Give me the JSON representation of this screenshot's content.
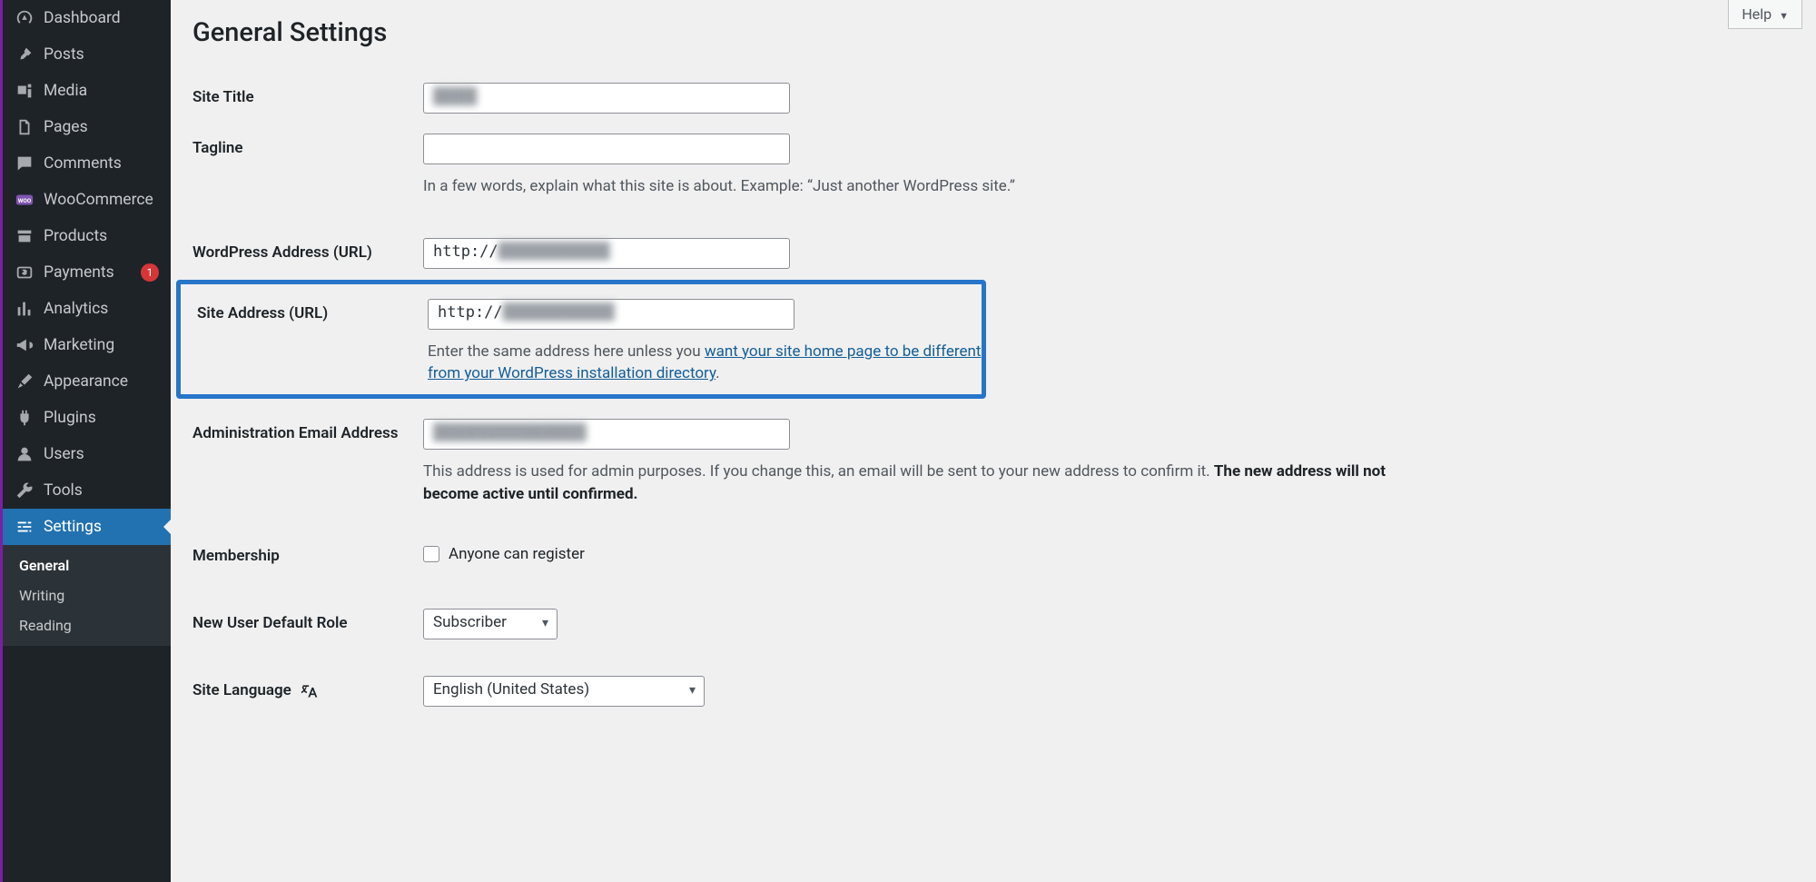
{
  "help_label": "Help",
  "page_title": "General Settings",
  "sidebar": {
    "items": [
      {
        "label": "Dashboard"
      },
      {
        "label": "Posts"
      },
      {
        "label": "Media"
      },
      {
        "label": "Pages"
      },
      {
        "label": "Comments"
      },
      {
        "label": "WooCommerce"
      },
      {
        "label": "Products"
      },
      {
        "label": "Payments",
        "badge": "1"
      },
      {
        "label": "Analytics"
      },
      {
        "label": "Marketing"
      },
      {
        "label": "Appearance"
      },
      {
        "label": "Plugins"
      },
      {
        "label": "Users"
      },
      {
        "label": "Tools"
      },
      {
        "label": "Settings"
      }
    ],
    "submenu": [
      {
        "label": "General"
      },
      {
        "label": "Writing"
      },
      {
        "label": "Reading"
      }
    ]
  },
  "form": {
    "site_title": {
      "label": "Site Title",
      "value": "████"
    },
    "tagline": {
      "label": "Tagline",
      "value": "",
      "description": "In a few words, explain what this site is about. Example: “Just another WordPress site.”"
    },
    "wp_url": {
      "label": "WordPress Address (URL)",
      "value_prefix": "http://",
      "value_blur": "████████████"
    },
    "site_url": {
      "label": "Site Address (URL)",
      "value_prefix": "http://",
      "value_blur": "████████████",
      "desc_before": "Enter the same address here unless you ",
      "desc_link": "want your site home page to be different from your WordPress installation directory",
      "desc_after": "."
    },
    "admin_email": {
      "label": "Administration Email Address",
      "value_blur": "██████████████",
      "desc_before": "This address is used for admin purposes. If you change this, an email will be sent to your new address to confirm it. ",
      "desc_strong": "The new address will not become active until confirmed."
    },
    "membership": {
      "label": "Membership",
      "check_label": "Anyone can register"
    },
    "new_user_role": {
      "label": "New User Default Role",
      "value": "Subscriber"
    },
    "site_language": {
      "label": "Site Language",
      "value": "English (United States)"
    }
  }
}
